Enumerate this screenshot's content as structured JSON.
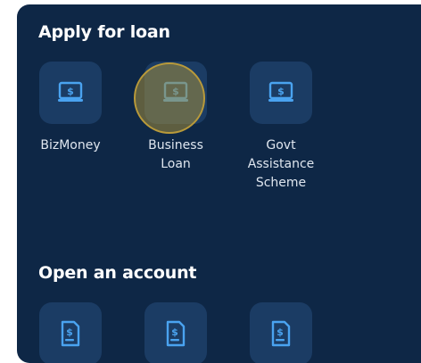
{
  "sections": {
    "loan": {
      "title": "Apply for loan",
      "items": [
        {
          "label": "BizMoney",
          "icon": "monitor-dollar-icon"
        },
        {
          "label": "Business\nLoan",
          "icon": "monitor-dollar-icon"
        },
        {
          "label": "Govt\nAssistance\nScheme",
          "icon": "monitor-dollar-icon"
        }
      ]
    },
    "account": {
      "title": "Open an account",
      "items": [
        {
          "icon": "document-dollar-icon"
        },
        {
          "icon": "document-dollar-icon"
        },
        {
          "icon": "document-dollar-icon"
        }
      ]
    }
  },
  "colors": {
    "panel": "#0e2746",
    "tile": "#1b3c64",
    "icon": "#4aa3f0",
    "highlight": "#b99a3a"
  }
}
